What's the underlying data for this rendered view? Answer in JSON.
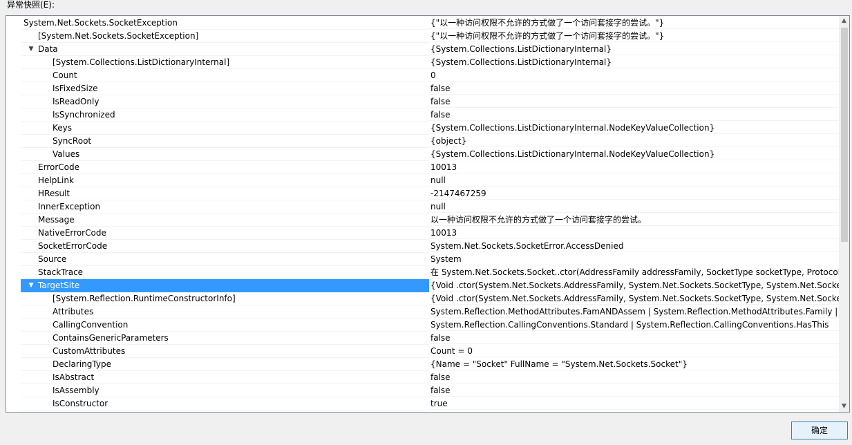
{
  "header": {
    "label": "异常快照(E):"
  },
  "tree": [
    {
      "level": 0,
      "expander": "expanded",
      "name": "System.Net.Sockets.SocketException",
      "value": "{\"以一种访问权限不允许的方式做了一个访问套接字的尝试。\"}"
    },
    {
      "level": 1,
      "expander": "none",
      "name": "[System.Net.Sockets.SocketException]",
      "value": "{\"以一种访问权限不允许的方式做了一个访问套接字的尝试。\"}"
    },
    {
      "level": 1,
      "expander": "expanded",
      "name": "Data",
      "value": "{System.Collections.ListDictionaryInternal}"
    },
    {
      "level": 2,
      "expander": "none",
      "name": "[System.Collections.ListDictionaryInternal]",
      "value": "{System.Collections.ListDictionaryInternal}"
    },
    {
      "level": 2,
      "expander": "none",
      "name": "Count",
      "value": "0"
    },
    {
      "level": 2,
      "expander": "none",
      "name": "IsFixedSize",
      "value": "false"
    },
    {
      "level": 2,
      "expander": "none",
      "name": "IsReadOnly",
      "value": "false"
    },
    {
      "level": 2,
      "expander": "none",
      "name": "IsSynchronized",
      "value": "false"
    },
    {
      "level": 2,
      "expander": "none",
      "name": "Keys",
      "value": "{System.Collections.ListDictionaryInternal.NodeKeyValueCollection}"
    },
    {
      "level": 2,
      "expander": "none",
      "name": "SyncRoot",
      "value": "{object}"
    },
    {
      "level": 2,
      "expander": "none",
      "name": "Values",
      "value": "{System.Collections.ListDictionaryInternal.NodeKeyValueCollection}"
    },
    {
      "level": 1,
      "expander": "none",
      "name": "ErrorCode",
      "value": "10013"
    },
    {
      "level": 1,
      "expander": "none",
      "name": "HelpLink",
      "value": "null"
    },
    {
      "level": 1,
      "expander": "none",
      "name": "HResult",
      "value": "-2147467259"
    },
    {
      "level": 1,
      "expander": "none",
      "name": "InnerException",
      "value": "null"
    },
    {
      "level": 1,
      "expander": "none",
      "name": "Message",
      "value": "以一种访问权限不允许的方式做了一个访问套接字的尝试。"
    },
    {
      "level": 1,
      "expander": "none",
      "name": "NativeErrorCode",
      "value": "10013"
    },
    {
      "level": 1,
      "expander": "none",
      "name": "SocketErrorCode",
      "value": "System.Net.Sockets.SocketError.AccessDenied"
    },
    {
      "level": 1,
      "expander": "none",
      "name": "Source",
      "value": "System"
    },
    {
      "level": 1,
      "expander": "none",
      "name": "StackTrace",
      "value": "   在 System.Net.Sockets.Socket..ctor(AddressFamily addressFamily, SocketType socketType, ProtocolType"
    },
    {
      "level": 1,
      "expander": "expanded",
      "name": "TargetSite",
      "value": "{Void .ctor(System.Net.Sockets.AddressFamily, System.Net.Sockets.SocketType, System.Net.Sockets.ProtocolType)}",
      "selected": true
    },
    {
      "level": 2,
      "expander": "none",
      "name": "[System.Reflection.RuntimeConstructorInfo]",
      "value": "{Void .ctor(System.Net.Sockets.AddressFamily, System.Net.Sockets.SocketType, System.Net.Sockets.ProtocolType)}"
    },
    {
      "level": 2,
      "expander": "none",
      "name": "Attributes",
      "value": "System.Reflection.MethodAttributes.FamANDAssem | System.Reflection.MethodAttributes.Family | System.Reflection.MethodAttributes.Public"
    },
    {
      "level": 2,
      "expander": "none",
      "name": "CallingConvention",
      "value": "System.Reflection.CallingConventions.Standard | System.Reflection.CallingConventions.HasThis"
    },
    {
      "level": 2,
      "expander": "none",
      "name": "ContainsGenericParameters",
      "value": "false"
    },
    {
      "level": 2,
      "expander": "none",
      "name": "CustomAttributes",
      "value": "Count = 0"
    },
    {
      "level": 2,
      "expander": "none",
      "name": "DeclaringType",
      "value": "{Name = \"Socket\" FullName = \"System.Net.Sockets.Socket\"}"
    },
    {
      "level": 2,
      "expander": "none",
      "name": "IsAbstract",
      "value": "false"
    },
    {
      "level": 2,
      "expander": "none",
      "name": "IsAssembly",
      "value": "false"
    },
    {
      "level": 2,
      "expander": "none",
      "name": "IsConstructor",
      "value": "true"
    }
  ],
  "buttons": {
    "ok_label": "确定"
  },
  "icons": {
    "expanded": "chevron-down-icon",
    "scroll_up": "chevron-up-icon",
    "scroll_down": "chevron-down-icon"
  },
  "colors": {
    "selection": "#3399ff",
    "border": "#828790",
    "scroll_thumb": "#cdcdcd"
  }
}
